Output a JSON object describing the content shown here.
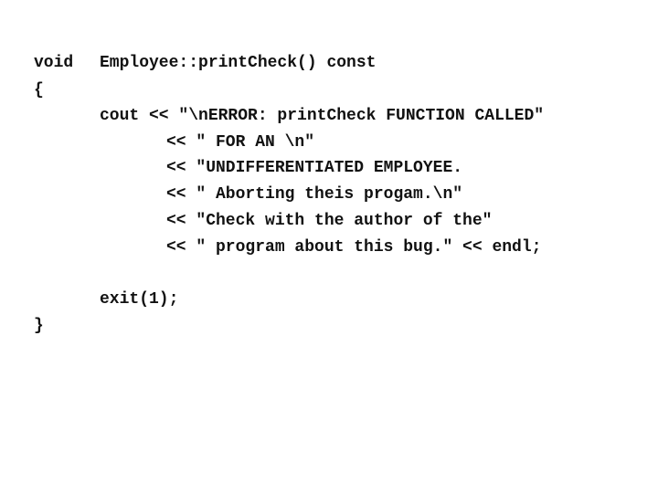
{
  "code": {
    "return_type": "void",
    "signature": "Employee::printCheck() const",
    "open_brace": "{",
    "cout_line": "cout << \"\\nERROR: printCheck FUNCTION CALLED\"",
    "continuation_lines": [
      "<< \" FOR AN \\n\"",
      "<< \"UNDIFFERENTIATED EMPLOYEE.",
      "<< \" Aborting theis progam.\\n\"",
      "<< \"Check with the author of the\"",
      "<< \" program about this bug.\" << endl;"
    ],
    "exit_line": "exit(1);",
    "close_brace": "}"
  }
}
